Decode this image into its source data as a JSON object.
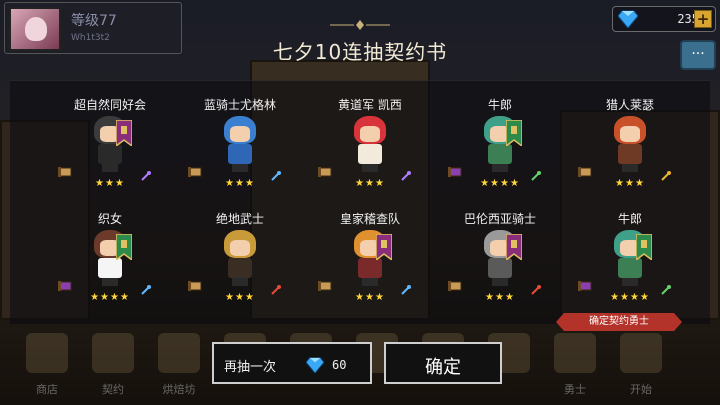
{
  "player": {
    "level": "等级77",
    "sub": "Wh1t3t2"
  },
  "gems": {
    "count": "235",
    "plus": "+"
  },
  "title": "七夕10连抽契约书",
  "heroes": [
    {
      "name": "超自然同好会",
      "stars": "★★★",
      "hair": "#3b3b3b",
      "outfit": "#2a2a2a",
      "banner": "#8a2d7a",
      "weapon": "#b07cff",
      "scroll": "#c89a55"
    },
    {
      "name": "蓝骑士尤格林",
      "stars": "★★★",
      "hair": "#3b7fd1",
      "outfit": "#2f66b5",
      "banner": "",
      "weapon": "#5fb7ff",
      "scroll": "#c89a55"
    },
    {
      "name": "黄道军 凯西",
      "stars": "★★★",
      "hair": "#d9343c",
      "outfit": "#f2eadb",
      "banner": "",
      "weapon": "#b07cff",
      "scroll": "#c89a55"
    },
    {
      "name": "牛郎",
      "stars": "★★★★",
      "hair": "#3fa08a",
      "outfit": "#3c7f54",
      "banner": "#2e8a4a",
      "weapon": "#64d26a",
      "scroll": "#8b3fb0"
    },
    {
      "name": "猎人莱瑟",
      "stars": "★★★",
      "hair": "#c9512a",
      "outfit": "#6e3a26",
      "banner": "",
      "weapon": "#e8b232",
      "scroll": "#c89a55"
    },
    {
      "name": "织女",
      "stars": "★★★★",
      "hair": "#6b3a2a",
      "outfit": "#f5f5f5",
      "banner": "#2e8a4a",
      "weapon": "#5fb7ff",
      "scroll": "#8b3fb0"
    },
    {
      "name": "绝地武士",
      "stars": "★★★",
      "hair": "#c99a3a",
      "outfit": "#3a2d24",
      "banner": "",
      "weapon": "#e84a3a",
      "scroll": "#c89a55"
    },
    {
      "name": "皇家稽查队",
      "stars": "★★★",
      "hair": "#e0902e",
      "outfit": "#7a2a2a",
      "banner": "#8a2d7a",
      "weapon": "#5fb7ff",
      "scroll": "#c89a55"
    },
    {
      "name": "巴伦西亚骑士",
      "stars": "★★★",
      "hair": "#9a9a9a",
      "outfit": "#5a5a5a",
      "banner": "#8a2d7a",
      "weapon": "#e84a3a",
      "scroll": "#c89a55"
    },
    {
      "name": "牛郎",
      "stars": "★★★★",
      "hair": "#3fa08a",
      "outfit": "#3c7f54",
      "banner": "#2e8a4a",
      "weapon": "#64d26a",
      "scroll": "#8b3fb0"
    }
  ],
  "confirm_tag": "确定契约勇士",
  "nav": [
    {
      "label": "商店"
    },
    {
      "label": "契约"
    },
    {
      "label": "烘焙坊"
    },
    {
      "label": ""
    },
    {
      "label": ""
    },
    {
      "label": ""
    },
    {
      "label": ""
    },
    {
      "label": ""
    },
    {
      "label": "勇士"
    },
    {
      "label": "开始"
    }
  ],
  "actions": {
    "again_label": "再抽一次",
    "again_cost": "60",
    "confirm_label": "确定"
  }
}
